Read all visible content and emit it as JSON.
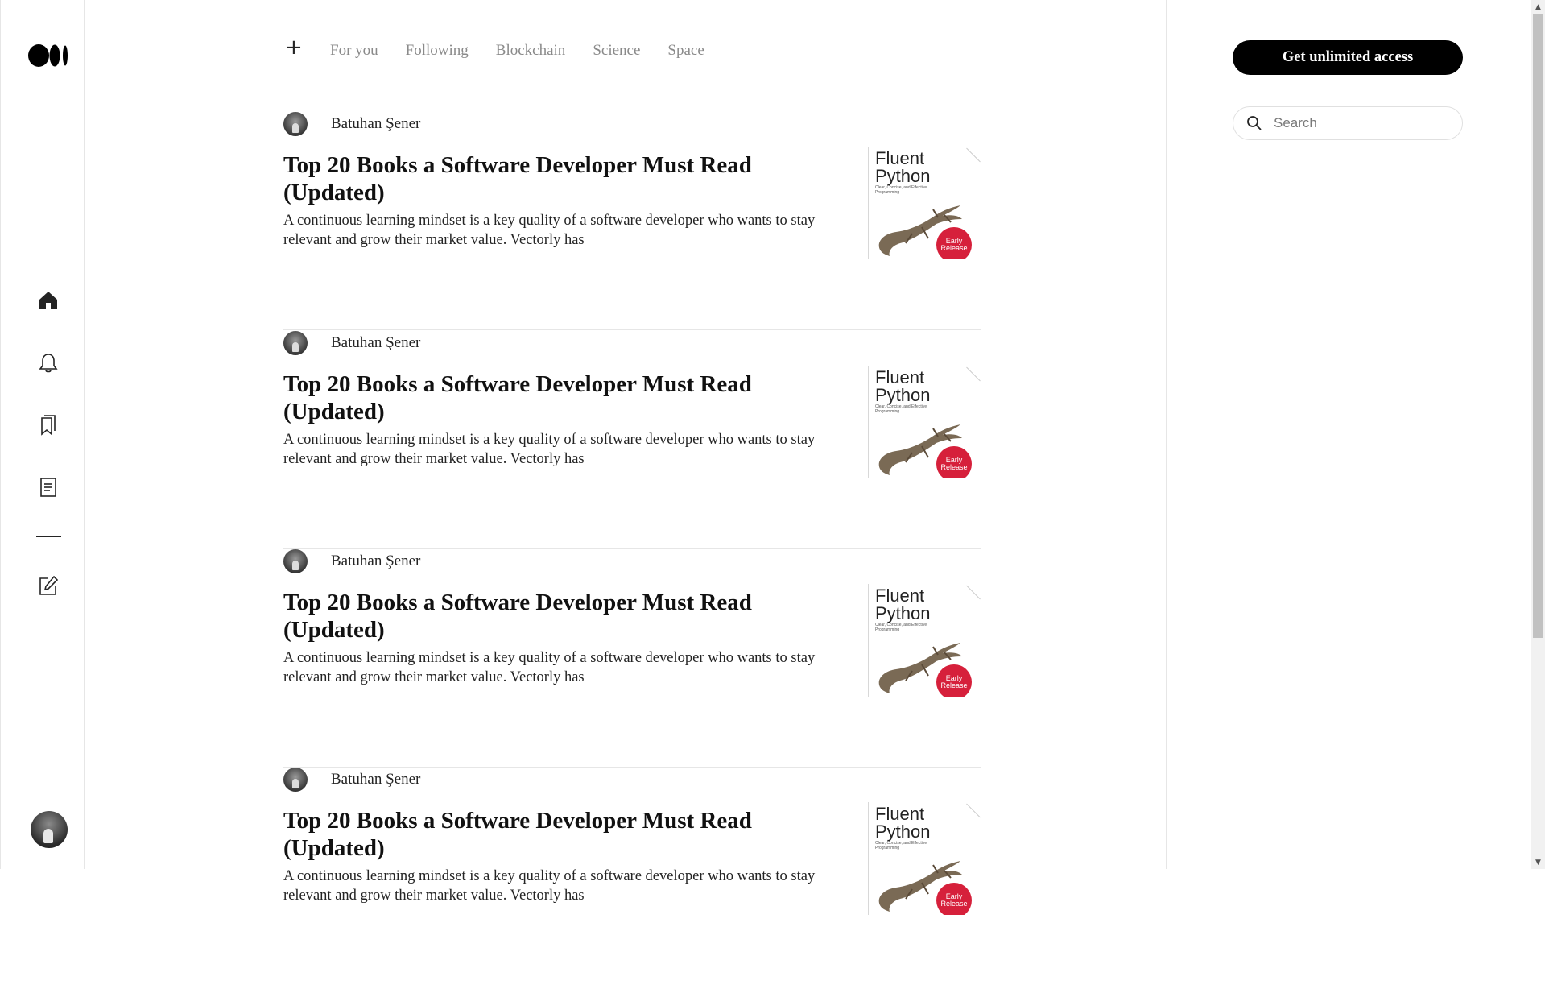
{
  "sidebar": {
    "icons": [
      "medium-logo-icon",
      "home-icon",
      "bell-icon",
      "bookmarks-icon",
      "stories-icon",
      "write-icon"
    ]
  },
  "tabs": {
    "add_label": "+",
    "items": [
      "For you",
      "Following",
      "Blockchain",
      "Science",
      "Space"
    ]
  },
  "articles": [
    {
      "author": "Batuhan Şener",
      "title": "Top 20 Books a Software Developer Must Read (Updated)",
      "excerpt": "A continuous learning mindset is a key quality of a software developer who wants to stay relevant and grow their market value. Vectorly has",
      "thumb_title": "Fluent Python",
      "thumb_subtitle": "Clear, Concise, and Effective Programming",
      "thumb_badge_line1": "Early",
      "thumb_badge_line2": "Release"
    },
    {
      "author": "Batuhan Şener",
      "title": "Top 20 Books a Software Developer Must Read (Updated)",
      "excerpt": "A continuous learning mindset is a key quality of a software developer who wants to stay relevant and grow their market value. Vectorly has",
      "thumb_title": "Fluent Python",
      "thumb_subtitle": "Clear, Concise, and Effective Programming",
      "thumb_badge_line1": "Early",
      "thumb_badge_line2": "Release"
    },
    {
      "author": "Batuhan Şener",
      "title": "Top 20 Books a Software Developer Must Read (Updated)",
      "excerpt": "A continuous learning mindset is a key quality of a software developer who wants to stay relevant and grow their market value. Vectorly has",
      "thumb_title": "Fluent Python",
      "thumb_subtitle": "Clear, Concise, and Effective Programming",
      "thumb_badge_line1": "Early",
      "thumb_badge_line2": "Release"
    },
    {
      "author": "Batuhan Şener",
      "title": "Top 20 Books a Software Developer Must Read (Updated)",
      "excerpt": "A continuous learning mindset is a key quality of a software developer who wants to stay relevant and grow their market value. Vectorly has",
      "thumb_title": "Fluent Python",
      "thumb_subtitle": "Clear, Concise, and Effective Programming",
      "thumb_badge_line1": "Early",
      "thumb_badge_line2": "Release"
    }
  ],
  "right": {
    "cta_label": "Get unlimited access",
    "search_placeholder": "Search"
  },
  "colors": {
    "accent": "#000000",
    "muted_text": "#8a8a8a",
    "badge_red": "#d6203b"
  }
}
